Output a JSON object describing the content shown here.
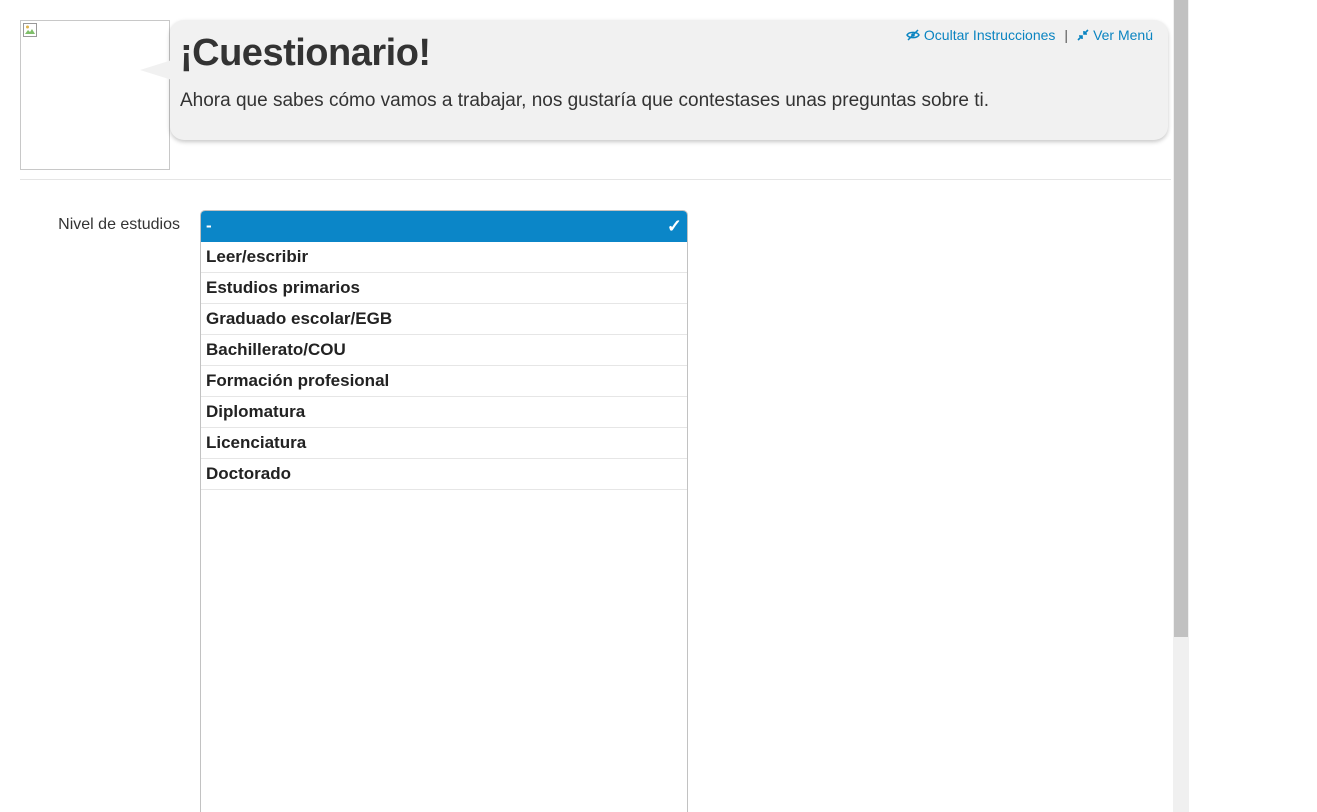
{
  "header": {
    "title": "¡Cuestionario!",
    "subtitle": "Ahora que sabes cómo vamos a trabajar, nos gustaría que contestases unas preguntas sobre ti.",
    "links": {
      "hide_instructions": "Ocultar Instrucciones",
      "separator": "|",
      "view_menu": "Ver Menú"
    },
    "link_color": "#0a84c1"
  },
  "form": {
    "education_label": "Nivel de estudios",
    "selected_index": 0,
    "options": [
      "-",
      "Leer/escribir",
      "Estudios primarios",
      "Graduado escolar/EGB",
      "Bachillerato/COU",
      "Formación profesional",
      "Diplomatura",
      "Licenciatura",
      "Doctorado"
    ],
    "selected_color": "#0b86c8",
    "check_glyph": "✓"
  },
  "icons": {
    "hide_instructions": "eye-slash-icon",
    "view_menu": "compress-arrows-icon",
    "avatar": "broken-image-icon"
  }
}
